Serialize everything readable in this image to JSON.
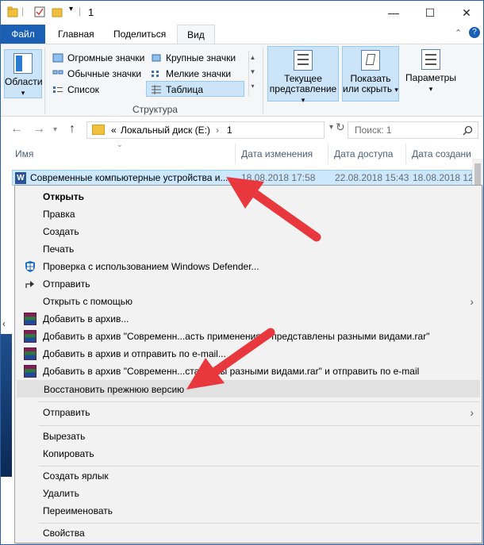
{
  "window": {
    "title": "1"
  },
  "titlebar": {
    "minimize": "—",
    "maximize": "☐",
    "close": "✕"
  },
  "ribbon_tabs": {
    "file": "Файл",
    "home": "Главная",
    "share": "Поделиться",
    "view": "Вид"
  },
  "ribbon": {
    "panes_label": "Области",
    "layout_items": {
      "huge_icons": "Огромные значки",
      "large_icons": "Крупные значки",
      "normal_icons": "Обычные значки",
      "small_icons": "Мелкие значки",
      "list": "Список",
      "table": "Таблица"
    },
    "layout_group": "Структура",
    "current_view_line1": "Текущее",
    "current_view_line2": "представление",
    "show_hide_line1": "Показать",
    "show_hide_line2": "или скрыть",
    "options": "Параметры"
  },
  "navigation": {
    "address_prefix": "«",
    "path_drive": "Локальный диск (E:)",
    "path_sep": "›",
    "path_folder": "1",
    "search_placeholder": "Поиск: 1"
  },
  "columns": {
    "name": "Имя",
    "modified": "Дата изменения",
    "accessed": "Дата доступа",
    "created": "Дата создани"
  },
  "file": {
    "name": "Современные компьютерные устройства и...",
    "modified": "18.08.2018 17:58",
    "accessed": "22.08.2018 15:43",
    "created": "18.08.2018 12:"
  },
  "context_menu": {
    "open": "Открыть",
    "edit": "Правка",
    "new": "Создать",
    "print": "Печать",
    "defender": "Проверка с использованием Windows Defender...",
    "share": "Отправить",
    "open_with": "Открыть с помощью",
    "add_archive": "Добавить в архив...",
    "add_named_rar": "Добавить в архив \"Современн...асть применения и представлены разными видами.rar\"",
    "add_and_email": "Добавить в архив и отправить по e-mail...",
    "add_named_rar_email": "Добавить в архив \"Современн...ставлены разными видами.rar\" и отправить по e-mail",
    "restore_previous": "Восстановить прежнюю версию",
    "send_to": "Отправить",
    "cut": "Вырезать",
    "copy": "Копировать",
    "create_shortcut": "Создать ярлык",
    "delete": "Удалить",
    "rename": "Переименовать",
    "properties": "Свойства"
  },
  "colors": {
    "accent": "#1a5fb4",
    "selection": "#cce8ff",
    "annotation_arrow": "#e8383d"
  }
}
